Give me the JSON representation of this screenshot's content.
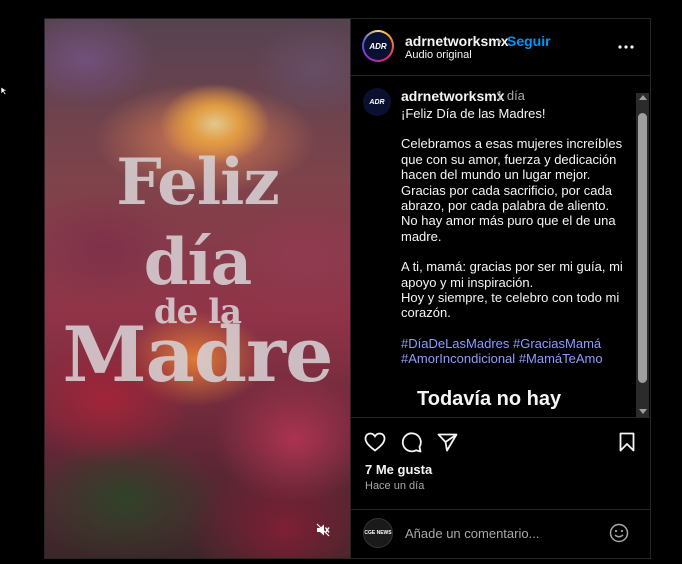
{
  "media": {
    "title_line1": "Feliz",
    "title_line2": "día",
    "title_line3": "de la",
    "title_line4": "Madre",
    "mute_icon": "speaker-muted-icon"
  },
  "header": {
    "username": "adrnetworksmx",
    "separator": "•",
    "follow_label": "Seguir",
    "audio_label": "Audio original",
    "avatar_logo": "ADR",
    "more_icon": "more-options-icon"
  },
  "caption": {
    "username": "adrnetworksmx",
    "time": "1 día",
    "avatar_logo": "ADR",
    "line_greeting": "¡Feliz Día de las Madres!",
    "paragraph1": "Celebramos a esas mujeres increíbles que con su amor, fuerza y dedicación hacen del mundo un lugar mejor. Gracias por cada sacrificio, por cada abrazo, por cada palabra de aliento. No hay amor más puro que el de una madre.",
    "paragraph2a": "A ti, mamá: gracias por ser mi guía, mi apoyo y mi inspiración.",
    "paragraph2b": "Hoy y siempre, te celebro con todo mi corazón.",
    "hashtags": [
      "#DíaDeLasMadres",
      "#GraciasMamá",
      "#AmorIncondicional",
      "#MamáTeAmo"
    ],
    "empty_comments": "Todavía no hay"
  },
  "actions": {
    "like_icon": "heart-icon",
    "comment_icon": "comment-icon",
    "share_icon": "share-icon",
    "save_icon": "bookmark-icon",
    "likes_text": "7 Me gusta",
    "time_ago": "Hace un día"
  },
  "comment": {
    "placeholder": "Añade un comentario...",
    "avatar_text": "CGE NEWS",
    "emoji_icon": "emoji-icon"
  },
  "colors": {
    "accent": "#0095f6",
    "hashtag": "#8e9bff",
    "background": "#000000"
  }
}
